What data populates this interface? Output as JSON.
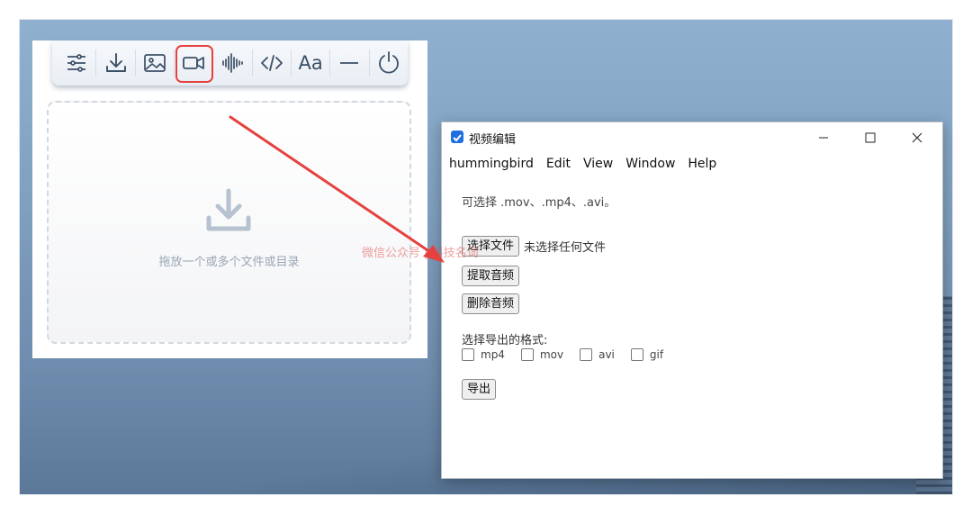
{
  "toolbar": {
    "items": [
      {
        "icon": "sliders-icon"
      },
      {
        "icon": "download-icon"
      },
      {
        "icon": "image-icon"
      },
      {
        "icon": "video-camera-icon",
        "active": true
      },
      {
        "icon": "audio-wave-icon"
      },
      {
        "icon": "code-icon"
      },
      {
        "icon": "font-icon",
        "label": "Aa"
      },
      {
        "icon": "minimize-icon"
      },
      {
        "icon": "power-icon"
      }
    ],
    "highlight_color": "#e5423f"
  },
  "dropzone": {
    "text": "拖放一个或多个文件或目录",
    "icon": "download-icon"
  },
  "window": {
    "title": "视频编辑",
    "menu": [
      "hummingbird",
      "Edit",
      "View",
      "Window",
      "Help"
    ],
    "hint": "可选择 .mov、.mp4、.avi。",
    "choose_file_label": "选择文件",
    "file_status": "未选择任何文件",
    "extract_audio_label": "提取音频",
    "remove_audio_label": "删除音频",
    "format_label": "选择导出的格式:",
    "formats": [
      "mp4",
      "mov",
      "avi",
      "gif"
    ],
    "export_label": "导出"
  },
  "watermark": "微信公众号 | 科技名词",
  "colors": {
    "accent": "#1f6fe0",
    "arrow": "#e5423f"
  }
}
